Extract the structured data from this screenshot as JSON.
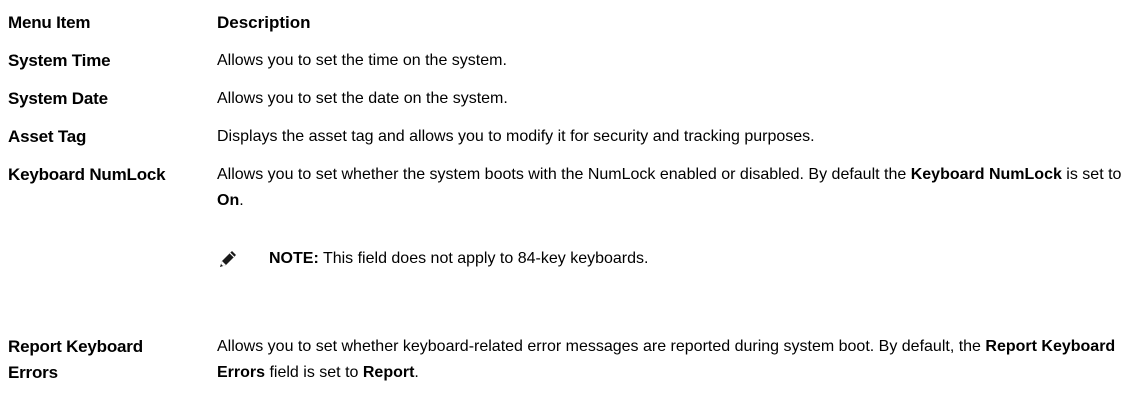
{
  "header": {
    "col1": "Menu Item",
    "col2": "Description"
  },
  "rows": [
    {
      "item": "System Time",
      "desc": "Allows you to set the time on the system."
    },
    {
      "item": "System Date",
      "desc": "Allows you to set the date on the system."
    },
    {
      "item": "Asset Tag",
      "desc": "Displays the asset tag and allows you to modify it for security and tracking purposes."
    },
    {
      "item": "Keyboard NumLock",
      "desc_a": "Allows you to set whether the system boots with the NumLock enabled or disabled. By default the ",
      "desc_b": "Keyboard NumLock",
      "desc_c": " is set to ",
      "desc_d": "On",
      "desc_e": ".",
      "note_label": "NOTE:",
      "note_text": " This field does not apply to 84-key keyboards."
    },
    {
      "item": "Report Keyboard Errors",
      "desc_a": "Allows you to set whether keyboard-related error messages are reported during system boot. By default, the ",
      "desc_b": "Report Keyboard Errors",
      "desc_c": " field is set to ",
      "desc_d": "Report",
      "desc_e": "."
    }
  ],
  "icons": {
    "note": "pencil-note-icon"
  }
}
